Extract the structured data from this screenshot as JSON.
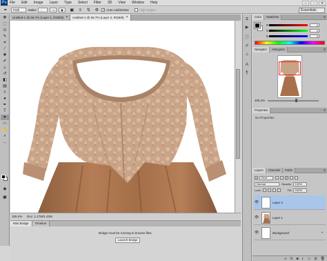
{
  "app": {
    "logo": "Ps"
  },
  "menu": [
    "File",
    "Edit",
    "Image",
    "Layer",
    "Type",
    "Select",
    "Filter",
    "3D",
    "View",
    "Window",
    "Help"
  ],
  "window_controls": {
    "minimize": "–",
    "restore": "▫",
    "close": "✕"
  },
  "options": {
    "path_mode": "Path",
    "make_label": "Make:",
    "auto_add_delete": "Auto Add/Delete",
    "align_edges": "Align Edges",
    "workspace": "Essentials"
  },
  "document": {
    "tabs": [
      {
        "label": "Untitled-1 @ 66.7% (Layer 1, RGB/8)",
        "close": "×",
        "active": false
      },
      {
        "label": "Untitled-1 @ 66.7% (Layer 2, RGB/8)",
        "close": "×",
        "active": true
      }
    ],
    "status": {
      "zoom": "106.4%",
      "doc": "Doc: 1.17M/1.42M"
    }
  },
  "mini_bridge": {
    "tabs": [
      "Mini Bridge",
      "Timeline"
    ],
    "message": "Bridge must be running to browse files.",
    "button": "Launch Bridge"
  },
  "panels": {
    "color": {
      "tabs": [
        "Color",
        "Swatches"
      ],
      "channels": [
        {
          "label": "R",
          "value": "0"
        },
        {
          "label": "G",
          "value": "0"
        },
        {
          "label": "B",
          "value": "0"
        }
      ]
    },
    "navigator": {
      "tabs": [
        "Navigator",
        "Histogram"
      ],
      "zoom": "106.4%"
    },
    "properties": {
      "tabs": [
        "Properties"
      ],
      "text": "No Properties"
    },
    "layers": {
      "tabs": [
        "Layers",
        "Channels",
        "Paths"
      ],
      "kind": "Kind",
      "blend_mode": "Normal",
      "opacity_label": "Opacity:",
      "opacity": "100%",
      "lock_label": "Lock:",
      "fill_label": "Fill:",
      "fill": "100%",
      "items": [
        {
          "name": "Layer 2",
          "selected": true,
          "italic": false,
          "lock": ""
        },
        {
          "name": "Layer 1",
          "selected": false,
          "italic": false,
          "lock": ""
        },
        {
          "name": "Background",
          "selected": false,
          "italic": true,
          "lock": "🔒"
        }
      ]
    }
  },
  "colors": {
    "accent": "#a9c6ea",
    "panel": "#c6c6c6",
    "canvas_bg": "#ffffff"
  }
}
